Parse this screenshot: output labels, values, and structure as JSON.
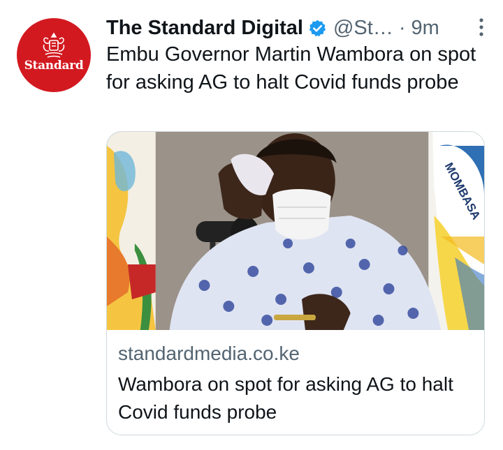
{
  "tweet": {
    "author": {
      "display_name": "The Standard Digital",
      "handle": "@St…",
      "verified": true,
      "avatar_wordmark": "Standard"
    },
    "separator": "·",
    "time": "9m",
    "text": "Embu Governor Martin Wambora on spot for asking AG to halt Covid funds probe",
    "card": {
      "domain": "standardmedia.co.ke",
      "title": "Wambora on spot for asking AG to halt Covid funds probe",
      "banner_text": "MOMBASA",
      "image_subject": "man-in-mask-wiping-face-at-microphone"
    }
  },
  "icons": [
    "verified-badge-icon",
    "more-options-icon",
    "standard-crest-icon"
  ],
  "colors": {
    "brand_red": "#d31920",
    "verified_blue": "#1d9bf0",
    "secondary_text": "#536471",
    "card_border": "#cfd9de"
  }
}
